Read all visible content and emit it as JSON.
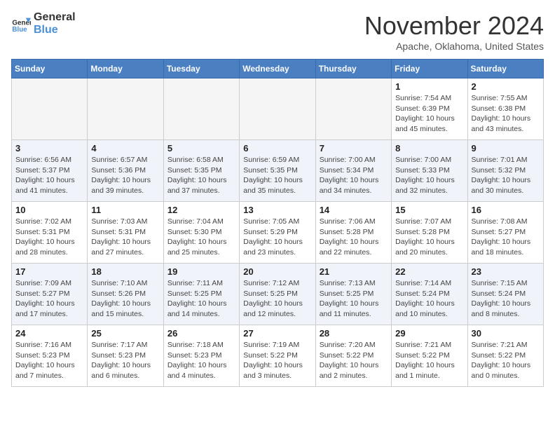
{
  "header": {
    "logo_line1": "General",
    "logo_line2": "Blue",
    "month": "November 2024",
    "location": "Apache, Oklahoma, United States"
  },
  "weekdays": [
    "Sunday",
    "Monday",
    "Tuesday",
    "Wednesday",
    "Thursday",
    "Friday",
    "Saturday"
  ],
  "weeks": [
    [
      {
        "day": "",
        "info": ""
      },
      {
        "day": "",
        "info": ""
      },
      {
        "day": "",
        "info": ""
      },
      {
        "day": "",
        "info": ""
      },
      {
        "day": "",
        "info": ""
      },
      {
        "day": "1",
        "info": "Sunrise: 7:54 AM\nSunset: 6:39 PM\nDaylight: 10 hours and 45 minutes."
      },
      {
        "day": "2",
        "info": "Sunrise: 7:55 AM\nSunset: 6:38 PM\nDaylight: 10 hours and 43 minutes."
      }
    ],
    [
      {
        "day": "3",
        "info": "Sunrise: 6:56 AM\nSunset: 5:37 PM\nDaylight: 10 hours and 41 minutes."
      },
      {
        "day": "4",
        "info": "Sunrise: 6:57 AM\nSunset: 5:36 PM\nDaylight: 10 hours and 39 minutes."
      },
      {
        "day": "5",
        "info": "Sunrise: 6:58 AM\nSunset: 5:35 PM\nDaylight: 10 hours and 37 minutes."
      },
      {
        "day": "6",
        "info": "Sunrise: 6:59 AM\nSunset: 5:35 PM\nDaylight: 10 hours and 35 minutes."
      },
      {
        "day": "7",
        "info": "Sunrise: 7:00 AM\nSunset: 5:34 PM\nDaylight: 10 hours and 34 minutes."
      },
      {
        "day": "8",
        "info": "Sunrise: 7:00 AM\nSunset: 5:33 PM\nDaylight: 10 hours and 32 minutes."
      },
      {
        "day": "9",
        "info": "Sunrise: 7:01 AM\nSunset: 5:32 PM\nDaylight: 10 hours and 30 minutes."
      }
    ],
    [
      {
        "day": "10",
        "info": "Sunrise: 7:02 AM\nSunset: 5:31 PM\nDaylight: 10 hours and 28 minutes."
      },
      {
        "day": "11",
        "info": "Sunrise: 7:03 AM\nSunset: 5:31 PM\nDaylight: 10 hours and 27 minutes."
      },
      {
        "day": "12",
        "info": "Sunrise: 7:04 AM\nSunset: 5:30 PM\nDaylight: 10 hours and 25 minutes."
      },
      {
        "day": "13",
        "info": "Sunrise: 7:05 AM\nSunset: 5:29 PM\nDaylight: 10 hours and 23 minutes."
      },
      {
        "day": "14",
        "info": "Sunrise: 7:06 AM\nSunset: 5:28 PM\nDaylight: 10 hours and 22 minutes."
      },
      {
        "day": "15",
        "info": "Sunrise: 7:07 AM\nSunset: 5:28 PM\nDaylight: 10 hours and 20 minutes."
      },
      {
        "day": "16",
        "info": "Sunrise: 7:08 AM\nSunset: 5:27 PM\nDaylight: 10 hours and 18 minutes."
      }
    ],
    [
      {
        "day": "17",
        "info": "Sunrise: 7:09 AM\nSunset: 5:27 PM\nDaylight: 10 hours and 17 minutes."
      },
      {
        "day": "18",
        "info": "Sunrise: 7:10 AM\nSunset: 5:26 PM\nDaylight: 10 hours and 15 minutes."
      },
      {
        "day": "19",
        "info": "Sunrise: 7:11 AM\nSunset: 5:25 PM\nDaylight: 10 hours and 14 minutes."
      },
      {
        "day": "20",
        "info": "Sunrise: 7:12 AM\nSunset: 5:25 PM\nDaylight: 10 hours and 12 minutes."
      },
      {
        "day": "21",
        "info": "Sunrise: 7:13 AM\nSunset: 5:25 PM\nDaylight: 10 hours and 11 minutes."
      },
      {
        "day": "22",
        "info": "Sunrise: 7:14 AM\nSunset: 5:24 PM\nDaylight: 10 hours and 10 minutes."
      },
      {
        "day": "23",
        "info": "Sunrise: 7:15 AM\nSunset: 5:24 PM\nDaylight: 10 hours and 8 minutes."
      }
    ],
    [
      {
        "day": "24",
        "info": "Sunrise: 7:16 AM\nSunset: 5:23 PM\nDaylight: 10 hours and 7 minutes."
      },
      {
        "day": "25",
        "info": "Sunrise: 7:17 AM\nSunset: 5:23 PM\nDaylight: 10 hours and 6 minutes."
      },
      {
        "day": "26",
        "info": "Sunrise: 7:18 AM\nSunset: 5:23 PM\nDaylight: 10 hours and 4 minutes."
      },
      {
        "day": "27",
        "info": "Sunrise: 7:19 AM\nSunset: 5:22 PM\nDaylight: 10 hours and 3 minutes."
      },
      {
        "day": "28",
        "info": "Sunrise: 7:20 AM\nSunset: 5:22 PM\nDaylight: 10 hours and 2 minutes."
      },
      {
        "day": "29",
        "info": "Sunrise: 7:21 AM\nSunset: 5:22 PM\nDaylight: 10 hours and 1 minute."
      },
      {
        "day": "30",
        "info": "Sunrise: 7:21 AM\nSunset: 5:22 PM\nDaylight: 10 hours and 0 minutes."
      }
    ]
  ]
}
